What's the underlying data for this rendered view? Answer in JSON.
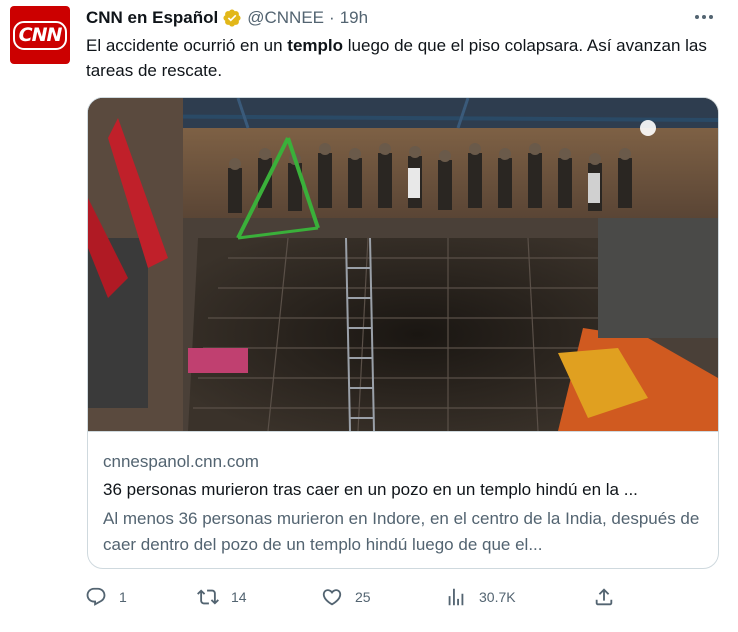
{
  "author": {
    "display_name": "CNN en Español",
    "handle": "@CNNEE",
    "time": "19h",
    "avatar_text": "CNN"
  },
  "tweet": {
    "text_before": "El accidente ocurrió en un ",
    "text_bold": "templo",
    "text_after": " luego de que el piso colapsara.  Así avanzan las tareas de rescate."
  },
  "card": {
    "domain": "cnnespanol.cnn.com",
    "title": "36 personas murieron tras caer en un pozo en un templo hindú en la ...",
    "description": "Al menos 36 personas murieron en Indore, en el centro de la India, después de caer dentro del pozo de un templo hindú luego de que el..."
  },
  "actions": {
    "replies": "1",
    "retweets": "14",
    "likes": "25",
    "views": "30.7K"
  },
  "colors": {
    "brand_red": "#cc0000",
    "verified_gold": "#e2b719",
    "muted": "#536471",
    "border": "#cfd9de"
  }
}
